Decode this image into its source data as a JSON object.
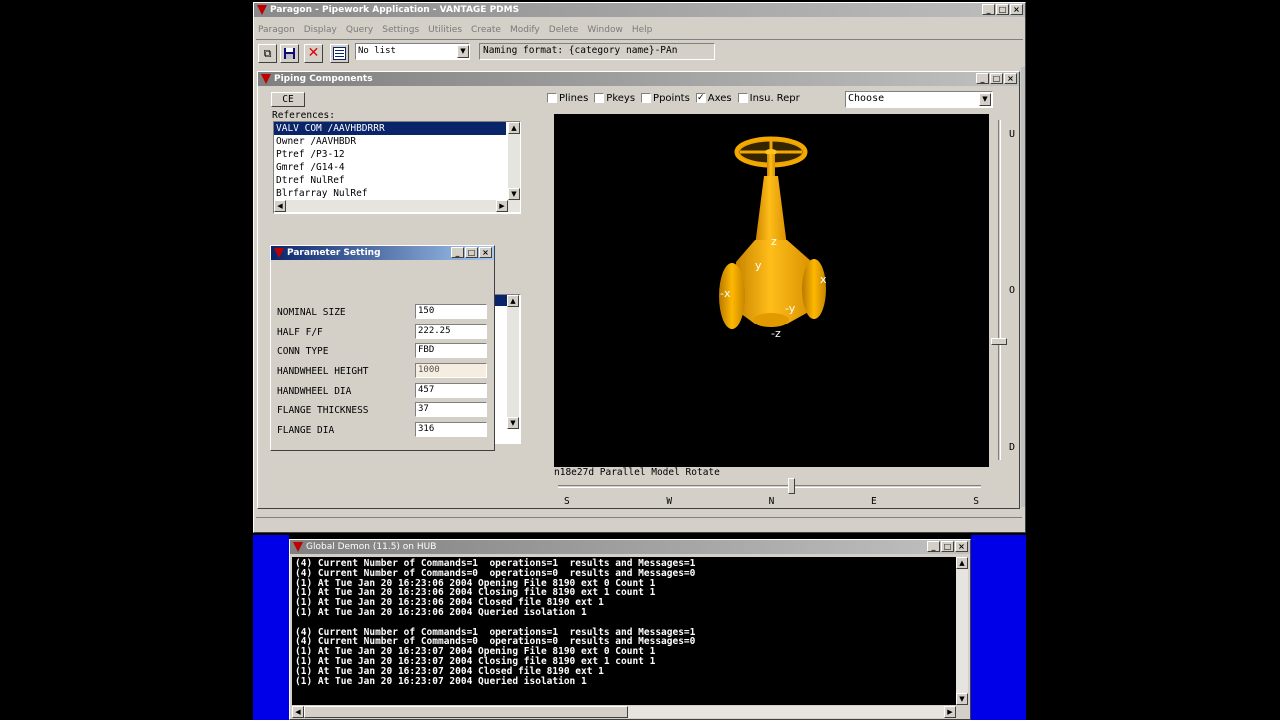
{
  "app": {
    "title": "Paragon - Pipework Application - VANTAGE PDMS",
    "menu": [
      "Paragon",
      "Display",
      "Query",
      "Settings",
      "Utilities",
      "Create",
      "Modify",
      "Delete",
      "Window",
      "Help"
    ],
    "list_select": "No list",
    "naming_format": "Naming format: {category name}-PAn"
  },
  "piping": {
    "title": "Piping Components",
    "ce_label": "CE",
    "references_label": "References:",
    "references": [
      "VALV COM /AAVHBDRRR",
      "Owner /AAVHBDR",
      "Ptref /P3-12",
      "Gmref /G14-4",
      "Dtref NulRef",
      "Blrfarray NulRef"
    ],
    "options": [
      {
        "label": "Plines",
        "checked": false
      },
      {
        "label": "Pkeys",
        "checked": false
      },
      {
        "label": "Ppoints",
        "checked": false
      },
      {
        "label": "Axes",
        "checked": true
      },
      {
        "label": "Insu.",
        "checked": false
      }
    ],
    "repr_label": "Repr",
    "repr_value": "Choose",
    "view_status": "n18e27d Parallel Model Rotate",
    "compass": [
      "S",
      "W",
      "N",
      "E",
      "S"
    ],
    "vertical_labels": [
      "U",
      "O",
      "D"
    ],
    "axis_labels": {
      "z": "z",
      "y": "y",
      "x": "x",
      "neg_x": "-x",
      "neg_y": "-y",
      "neg_z": "-z"
    },
    "colors": {
      "valve": "#f2a900",
      "viewport": "#000000"
    }
  },
  "params": {
    "title": "Parameter Setting",
    "rows": [
      {
        "label": "NOMINAL SIZE",
        "value": "150"
      },
      {
        "label": "HALF F/F",
        "value": "222.25"
      },
      {
        "label": "CONN TYPE",
        "value": "FBD"
      },
      {
        "label": "HANDWHEEL HEIGHT",
        "value": "1000"
      },
      {
        "label": "HANDWHEEL DIA",
        "value": "457"
      },
      {
        "label": "FLANGE THICKNESS",
        "value": "37"
      },
      {
        "label": "FLANGE DIA",
        "value": "316"
      }
    ]
  },
  "console": {
    "title": "Global Demon (11.5) on HUB",
    "lines": [
      "(4) Current Number of Commands=1  operations=1  results and Messages=1",
      "(4) Current Number of Commands=0  operations=0  results and Messages=0",
      "(1) At Tue Jan 20 16:23:06 2004 Opening File 8190 ext 0 Count 1",
      "(1) At Tue Jan 20 16:23:06 2004 Closing file 8190 ext 1 count 1",
      "(1) At Tue Jan 20 16:23:06 2004 Closed file 8190 ext 1",
      "(1) At Tue Jan 20 16:23:06 2004 Queried isolation 1",
      "",
      "(4) Current Number of Commands=1  operations=1  results and Messages=1",
      "(4) Current Number of Commands=0  operations=0  results and Messages=0",
      "(1) At Tue Jan 20 16:23:07 2004 Opening File 8190 ext 0 Count 1",
      "(1) At Tue Jan 20 16:23:07 2004 Closing file 8190 ext 1 count 1",
      "(1) At Tue Jan 20 16:23:07 2004 Closed file 8190 ext 1",
      "(1) At Tue Jan 20 16:23:07 2004 Queried isolation 1"
    ]
  }
}
